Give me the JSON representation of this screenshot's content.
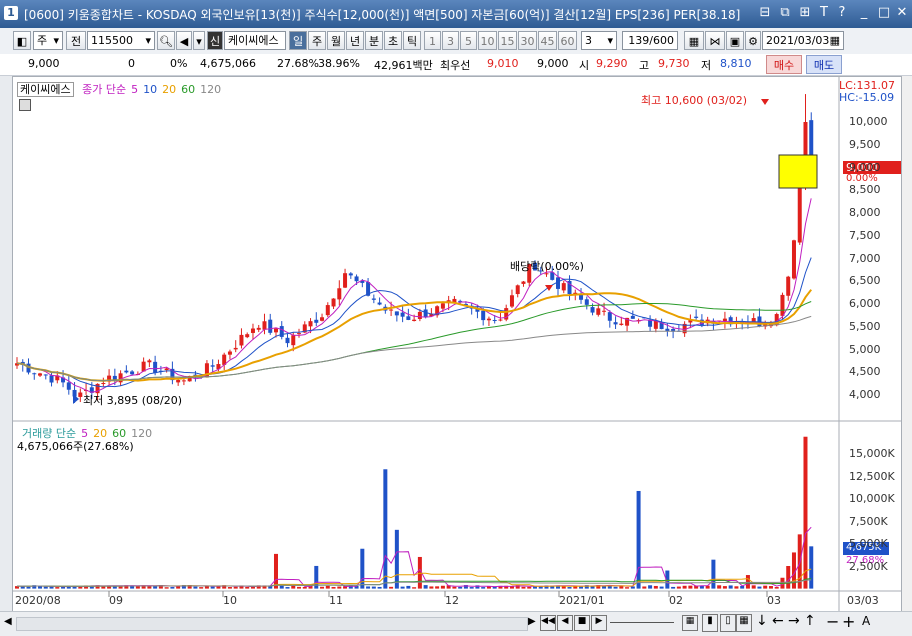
{
  "window": {
    "app_number": "1",
    "title": "[0600] 키움종합차트 - KOSDAQ 외국인보유[13(천)] 주식수[12,000(천)] 액면[500] 자본금[60(억)] 결산[12월] EPS[236] PER[38.18]",
    "icons": [
      "restore-icon",
      "copy-icon",
      "pin-icon",
      "help-icon",
      "minimize-icon",
      "close-icon"
    ]
  },
  "toolbar": {
    "period_select": "주",
    "prev_label": "전",
    "code": "115500",
    "flag_label": "신",
    "stock_name": "케이씨에스",
    "tabs": [
      "일",
      "주",
      "월",
      "년",
      "분",
      "초",
      "틱"
    ],
    "active_tab": "일",
    "intervals": [
      "1",
      "3",
      "5",
      "10",
      "15",
      "30",
      "45",
      "60"
    ],
    "interval_input": "3",
    "count": "139/600",
    "date": "2021/03/03"
  },
  "info": {
    "price": "9,000",
    "change": "0",
    "change_pct": "0%",
    "volume": "4,675,066",
    "turnover": "27.68%",
    "ratio": "38.96%",
    "amount": "42,961백만",
    "best_offer_label": "최우선",
    "best_offer": "9,010",
    "best_bid": "9,000",
    "open_label": "시",
    "open": "9,290",
    "high_label": "고",
    "high": "9,730",
    "low_label": "저",
    "low": "8,810",
    "buy_label": "매수",
    "sell_label": "매도"
  },
  "price_panel": {
    "legend_name": "케이씨에스",
    "legend_items": [
      {
        "label": "종가 단순",
        "color": "#c020c0"
      },
      {
        "label": "5",
        "color": "#c020c0"
      },
      {
        "label": "10",
        "color": "#1f52c8"
      },
      {
        "label": "20",
        "color": "#e8a000"
      },
      {
        "label": "60",
        "color": "#2a9a2a"
      },
      {
        "label": "120",
        "color": "#888888"
      }
    ],
    "lc": "LC:131.07",
    "hc": "HC:-15.09",
    "high_annot": "최고 10,600 (03/02)",
    "low_annot": "최저 3,895 (08/20)",
    "dividend_annot": "배당락(0.00%)",
    "current_price_tag": "9,000",
    "current_pct_tag": "0.00%",
    "y_ticks": [
      "10,000",
      "9,500",
      "9,000",
      "8,500",
      "8,000",
      "7,500",
      "7,000",
      "6,500",
      "6,000",
      "5,500",
      "5,000",
      "4,500",
      "4,000"
    ]
  },
  "volume_panel": {
    "legend_items": [
      {
        "label": "거래량 단순",
        "color": "#2a9a9a"
      },
      {
        "label": "5",
        "color": "#c020c0"
      },
      {
        "label": "20",
        "color": "#e8a000"
      },
      {
        "label": "60",
        "color": "#2a9a2a"
      },
      {
        "label": "120",
        "color": "#888888"
      }
    ],
    "summary": "4,675,066주(27.68%)",
    "volume_tag": "4,675K",
    "pct_tag": "27.68%",
    "y_ticks": [
      "15,000K",
      "12,500K",
      "10,000K",
      "7,500K",
      "5,000K",
      "2,500K"
    ]
  },
  "x_axis": {
    "labels": [
      "2020/08",
      "09",
      "10",
      "11",
      "12",
      "2021/01",
      "02",
      "03"
    ],
    "right_label": "03/03"
  },
  "colors": {
    "up": "#e0201c",
    "down": "#1f52c8",
    "ma5": "#c020c0",
    "ma10": "#1f52c8",
    "ma20": "#e8a000",
    "ma60": "#2a9a2a",
    "ma120": "#888888"
  }
}
